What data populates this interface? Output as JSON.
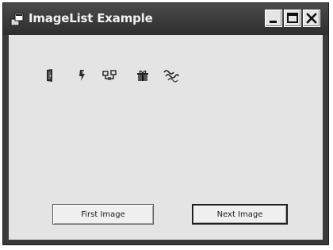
{
  "window": {
    "title": "ImageList Example"
  },
  "image_row": {
    "icons": [
      "door-icon",
      "lightning-icon",
      "network-icon",
      "gift-icon",
      "waves-icon"
    ]
  },
  "buttons": {
    "first_label": "First Image",
    "second_label": "Next Image"
  },
  "colors": {
    "titlebar": "#3a3a3a",
    "client_background": "#e4e4e4",
    "button_face": "#f0f0f0"
  }
}
